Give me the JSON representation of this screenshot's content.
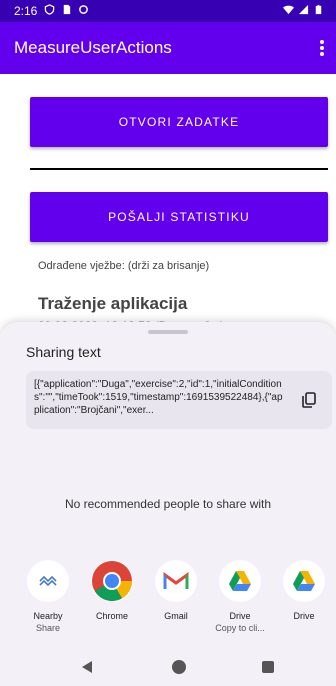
{
  "status": {
    "time": "2:16"
  },
  "app_bar": {
    "title": "MeasureUserActions"
  },
  "main": {
    "open_tasks_label": "OTVORI ZADATKE",
    "send_stats_label": "POŠALJI STATISTIKU",
    "hint": "Odrađene vježbe: (drži za brisanje)",
    "list_item_title": "Traženje aplikacija",
    "list_item_sub": "09.08.2023. 12:12:52 (Duga ... 0 s)"
  },
  "sheet": {
    "title": "Sharing text",
    "preview_text": "[{\"application\":\"Duga\",\"exercise\":2,\"id\":1,\"initialConditions\":\"\",\"timeTook\":1519,\"timestamp\":1691539522484},{\"application\":\"Brojčani\",\"exer...",
    "no_recommended": "No recommended people to share with",
    "targets": [
      {
        "label": "Nearby",
        "sub": "Share",
        "icon": "nearby-share-icon"
      },
      {
        "label": "Chrome",
        "sub": "",
        "icon": "chrome-icon"
      },
      {
        "label": "Gmail",
        "sub": "",
        "icon": "gmail-icon"
      },
      {
        "label": "Drive",
        "sub": "Copy to cli...",
        "icon": "drive-icon"
      },
      {
        "label": "Drive",
        "sub": "",
        "icon": "drive-icon"
      }
    ]
  },
  "colors": {
    "primary": "#6200ee",
    "primary_dark": "#3700b3",
    "sheet_bg": "#f3f0f7"
  }
}
